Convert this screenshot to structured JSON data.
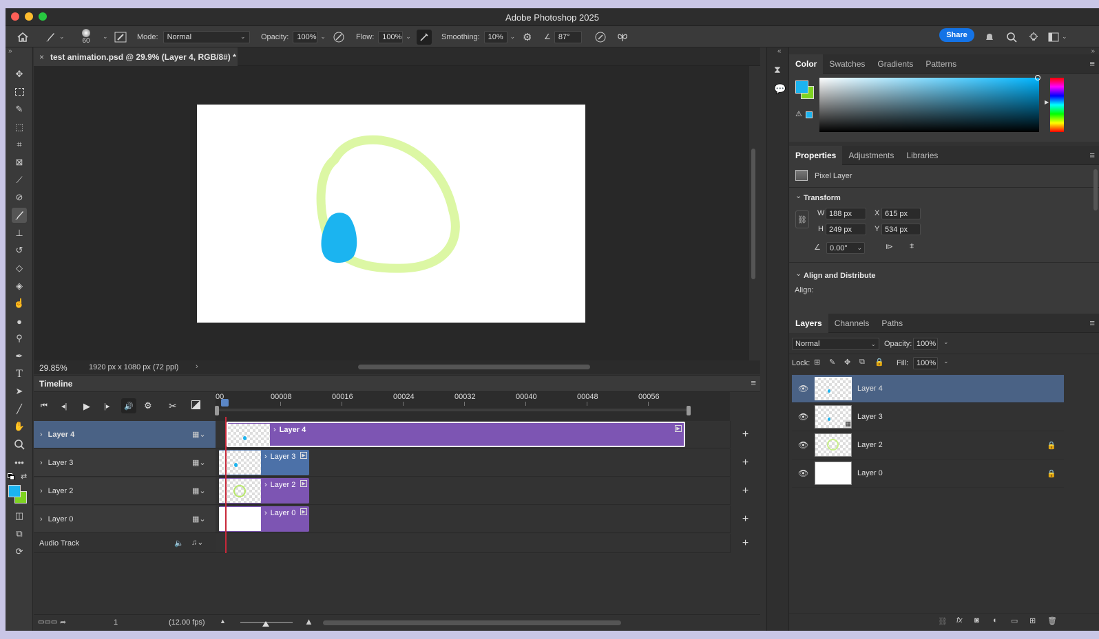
{
  "app": {
    "title": "Adobe Photoshop 2025"
  },
  "options_bar": {
    "brush_size": "60",
    "mode_label": "Mode:",
    "mode_value": "Normal",
    "opacity_label": "Opacity:",
    "opacity_value": "100%",
    "flow_label": "Flow:",
    "flow_value": "100%",
    "smoothing_label": "Smoothing:",
    "smoothing_value": "10%",
    "angle_value": "87°",
    "share_label": "Share"
  },
  "document": {
    "tab_title": "test animation.psd @ 29.9% (Layer 4, RGB/8#) *",
    "zoom": "29.85%",
    "size_info": "1920 px x 1080 px (72 ppi)"
  },
  "timeline": {
    "title": "Timeline",
    "ruler_ticks": [
      "00",
      "00008",
      "00016",
      "00024",
      "00032",
      "00040",
      "00048",
      "00056"
    ],
    "layers": [
      {
        "name": "Layer 4",
        "clip_label": "Layer 4",
        "selected": true
      },
      {
        "name": "Layer 3",
        "clip_label": "Layer 3",
        "selected": false
      },
      {
        "name": "Layer 2",
        "clip_label": "Layer 2",
        "selected": false
      },
      {
        "name": "Layer 0",
        "clip_label": "Layer 0",
        "selected": false
      }
    ],
    "audio_track": "Audio Track",
    "frame": "1",
    "fps": "(12.00 fps)"
  },
  "color_panel": {
    "tabs": [
      "Color",
      "Swatches",
      "Gradients",
      "Patterns"
    ],
    "fg_color": "#1bb4f0",
    "bg_color": "#7ed321"
  },
  "properties_panel": {
    "tabs": [
      "Properties",
      "Adjustments",
      "Libraries"
    ],
    "layer_type": "Pixel Layer",
    "transform_title": "Transform",
    "w_label": "W",
    "w_value": "188 px",
    "h_label": "H",
    "h_value": "249 px",
    "x_label": "X",
    "x_value": "615 px",
    "y_label": "Y",
    "y_value": "534 px",
    "angle_value": "0.00°",
    "align_title": "Align and Distribute",
    "align_label": "Align:"
  },
  "layers_panel": {
    "tabs": [
      "Layers",
      "Channels",
      "Paths"
    ],
    "blend_mode": "Normal",
    "opacity_label": "Opacity:",
    "opacity_value": "100%",
    "lock_label": "Lock:",
    "fill_label": "Fill:",
    "fill_value": "100%",
    "layers": [
      {
        "name": "Layer 4",
        "selected": true,
        "locked": false
      },
      {
        "name": "Layer 3",
        "selected": false,
        "locked": false
      },
      {
        "name": "Layer 2",
        "selected": false,
        "locked": true
      },
      {
        "name": "Layer 0",
        "selected": false,
        "locked": true
      }
    ]
  }
}
